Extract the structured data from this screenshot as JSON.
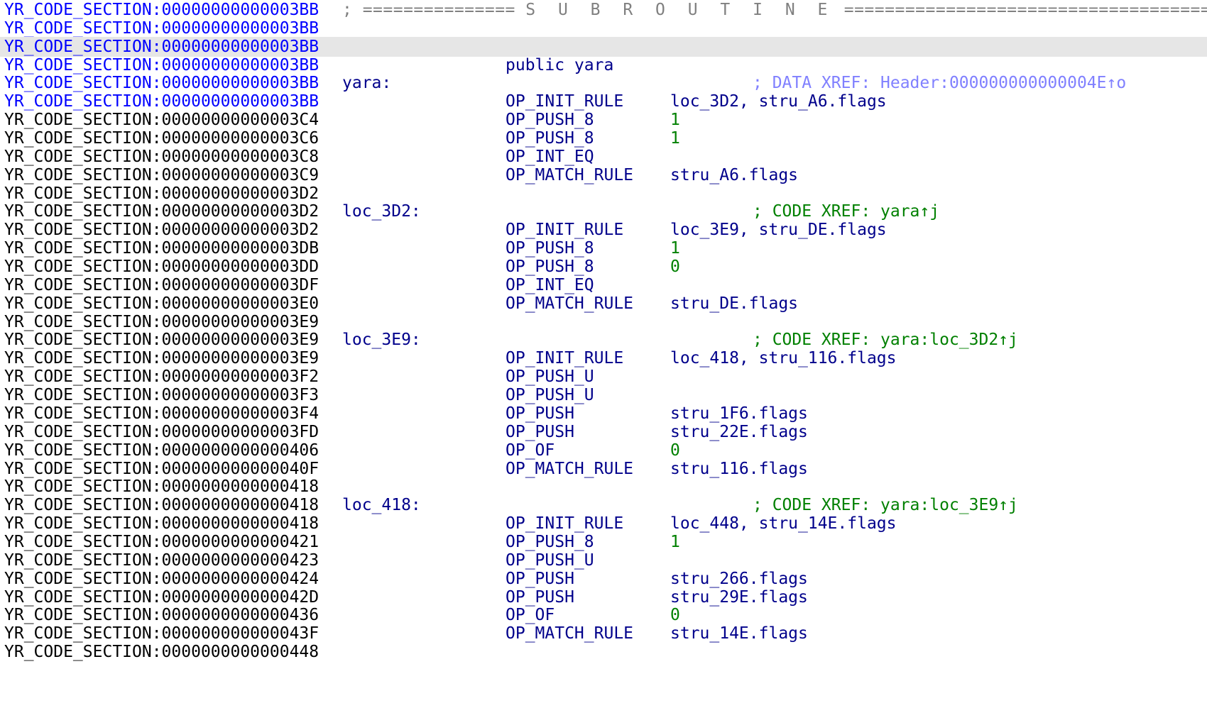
{
  "header": {
    "address": "YR_CODE_SECTION:00000000000003BB",
    "separator_left": "; ===============",
    "title": "S U B R O U T I N E",
    "separator_right": "========================================"
  },
  "rows": [
    {
      "addr": "YR_CODE_SECTION:00000000000003BB",
      "addr_color": "blue",
      "label": "",
      "mnemonic": "",
      "operand": "",
      "operand_kind": "",
      "xref": "",
      "xref_kind": ""
    },
    {
      "addr": "YR_CODE_SECTION:00000000000003BB",
      "addr_color": "blue",
      "label": "",
      "mnemonic": "",
      "operand": "",
      "operand_kind": "",
      "xref": "",
      "xref_kind": "",
      "highlight": true
    },
    {
      "addr": "YR_CODE_SECTION:00000000000003BB",
      "addr_color": "blue",
      "label": "",
      "mnemonic": "public yara",
      "operand": "",
      "operand_kind": "",
      "xref": "",
      "xref_kind": ""
    },
    {
      "addr": "YR_CODE_SECTION:00000000000003BB",
      "addr_color": "blue",
      "label": "yara:",
      "mnemonic": "",
      "operand": "",
      "operand_kind": "",
      "xref": "; DATA XREF: Header:000000000000004E↑o",
      "xref_kind": "data"
    },
    {
      "addr": "YR_CODE_SECTION:00000000000003BB",
      "addr_color": "blue",
      "label": "",
      "mnemonic": "OP_INIT_RULE",
      "operand": "loc_3D2, stru_A6.flags",
      "operand_kind": "name",
      "xref": "",
      "xref_kind": ""
    },
    {
      "addr": "YR_CODE_SECTION:00000000000003C4",
      "addr_color": "black",
      "label": "",
      "mnemonic": "OP_PUSH_8",
      "operand": "1",
      "operand_kind": "num",
      "xref": "",
      "xref_kind": ""
    },
    {
      "addr": "YR_CODE_SECTION:00000000000003C6",
      "addr_color": "black",
      "label": "",
      "mnemonic": "OP_PUSH_8",
      "operand": "1",
      "operand_kind": "num",
      "xref": "",
      "xref_kind": ""
    },
    {
      "addr": "YR_CODE_SECTION:00000000000003C8",
      "addr_color": "black",
      "label": "",
      "mnemonic": "OP_INT_EQ",
      "operand": "",
      "operand_kind": "",
      "xref": "",
      "xref_kind": ""
    },
    {
      "addr": "YR_CODE_SECTION:00000000000003C9",
      "addr_color": "black",
      "label": "",
      "mnemonic": "OP_MATCH_RULE",
      "operand": "stru_A6.flags",
      "operand_kind": "name",
      "xref": "",
      "xref_kind": ""
    },
    {
      "addr": "YR_CODE_SECTION:00000000000003D2",
      "addr_color": "black",
      "label": "",
      "mnemonic": "",
      "operand": "",
      "operand_kind": "",
      "xref": "",
      "xref_kind": ""
    },
    {
      "addr": "YR_CODE_SECTION:00000000000003D2",
      "addr_color": "black",
      "label": "loc_3D2:",
      "mnemonic": "",
      "operand": "",
      "operand_kind": "",
      "xref": "; CODE XREF: yara↑j",
      "xref_kind": "code"
    },
    {
      "addr": "YR_CODE_SECTION:00000000000003D2",
      "addr_color": "black",
      "label": "",
      "mnemonic": "OP_INIT_RULE",
      "operand": "loc_3E9, stru_DE.flags",
      "operand_kind": "name",
      "xref": "",
      "xref_kind": ""
    },
    {
      "addr": "YR_CODE_SECTION:00000000000003DB",
      "addr_color": "black",
      "label": "",
      "mnemonic": "OP_PUSH_8",
      "operand": "1",
      "operand_kind": "num",
      "xref": "",
      "xref_kind": ""
    },
    {
      "addr": "YR_CODE_SECTION:00000000000003DD",
      "addr_color": "black",
      "label": "",
      "mnemonic": "OP_PUSH_8",
      "operand": "0",
      "operand_kind": "num",
      "xref": "",
      "xref_kind": ""
    },
    {
      "addr": "YR_CODE_SECTION:00000000000003DF",
      "addr_color": "black",
      "label": "",
      "mnemonic": "OP_INT_EQ",
      "operand": "",
      "operand_kind": "",
      "xref": "",
      "xref_kind": ""
    },
    {
      "addr": "YR_CODE_SECTION:00000000000003E0",
      "addr_color": "black",
      "label": "",
      "mnemonic": "OP_MATCH_RULE",
      "operand": "stru_DE.flags",
      "operand_kind": "name",
      "xref": "",
      "xref_kind": ""
    },
    {
      "addr": "YR_CODE_SECTION:00000000000003E9",
      "addr_color": "black",
      "label": "",
      "mnemonic": "",
      "operand": "",
      "operand_kind": "",
      "xref": "",
      "xref_kind": ""
    },
    {
      "addr": "YR_CODE_SECTION:00000000000003E9",
      "addr_color": "black",
      "label": "loc_3E9:",
      "mnemonic": "",
      "operand": "",
      "operand_kind": "",
      "xref": "; CODE XREF: yara:loc_3D2↑j",
      "xref_kind": "code"
    },
    {
      "addr": "YR_CODE_SECTION:00000000000003E9",
      "addr_color": "black",
      "label": "",
      "mnemonic": "OP_INIT_RULE",
      "operand": "loc_418, stru_116.flags",
      "operand_kind": "name",
      "xref": "",
      "xref_kind": ""
    },
    {
      "addr": "YR_CODE_SECTION:00000000000003F2",
      "addr_color": "black",
      "label": "",
      "mnemonic": "OP_PUSH_U",
      "operand": "",
      "operand_kind": "",
      "xref": "",
      "xref_kind": ""
    },
    {
      "addr": "YR_CODE_SECTION:00000000000003F3",
      "addr_color": "black",
      "label": "",
      "mnemonic": "OP_PUSH_U",
      "operand": "",
      "operand_kind": "",
      "xref": "",
      "xref_kind": ""
    },
    {
      "addr": "YR_CODE_SECTION:00000000000003F4",
      "addr_color": "black",
      "label": "",
      "mnemonic": "OP_PUSH",
      "operand": "stru_1F6.flags",
      "operand_kind": "name",
      "xref": "",
      "xref_kind": ""
    },
    {
      "addr": "YR_CODE_SECTION:00000000000003FD",
      "addr_color": "black",
      "label": "",
      "mnemonic": "OP_PUSH",
      "operand": "stru_22E.flags",
      "operand_kind": "name",
      "xref": "",
      "xref_kind": ""
    },
    {
      "addr": "YR_CODE_SECTION:0000000000000406",
      "addr_color": "black",
      "label": "",
      "mnemonic": "OP_OF",
      "operand": "0",
      "operand_kind": "num",
      "xref": "",
      "xref_kind": ""
    },
    {
      "addr": "YR_CODE_SECTION:000000000000040F",
      "addr_color": "black",
      "label": "",
      "mnemonic": "OP_MATCH_RULE",
      "operand": "stru_116.flags",
      "operand_kind": "name",
      "xref": "",
      "xref_kind": ""
    },
    {
      "addr": "YR_CODE_SECTION:0000000000000418",
      "addr_color": "black",
      "label": "",
      "mnemonic": "",
      "operand": "",
      "operand_kind": "",
      "xref": "",
      "xref_kind": ""
    },
    {
      "addr": "YR_CODE_SECTION:0000000000000418",
      "addr_color": "black",
      "label": "loc_418:",
      "mnemonic": "",
      "operand": "",
      "operand_kind": "",
      "xref": "; CODE XREF: yara:loc_3E9↑j",
      "xref_kind": "code"
    },
    {
      "addr": "YR_CODE_SECTION:0000000000000418",
      "addr_color": "black",
      "label": "",
      "mnemonic": "OP_INIT_RULE",
      "operand": "loc_448, stru_14E.flags",
      "operand_kind": "name",
      "xref": "",
      "xref_kind": ""
    },
    {
      "addr": "YR_CODE_SECTION:0000000000000421",
      "addr_color": "black",
      "label": "",
      "mnemonic": "OP_PUSH_8",
      "operand": "1",
      "operand_kind": "num",
      "xref": "",
      "xref_kind": ""
    },
    {
      "addr": "YR_CODE_SECTION:0000000000000423",
      "addr_color": "black",
      "label": "",
      "mnemonic": "OP_PUSH_U",
      "operand": "",
      "operand_kind": "",
      "xref": "",
      "xref_kind": ""
    },
    {
      "addr": "YR_CODE_SECTION:0000000000000424",
      "addr_color": "black",
      "label": "",
      "mnemonic": "OP_PUSH",
      "operand": "stru_266.flags",
      "operand_kind": "name",
      "xref": "",
      "xref_kind": ""
    },
    {
      "addr": "YR_CODE_SECTION:000000000000042D",
      "addr_color": "black",
      "label": "",
      "mnemonic": "OP_PUSH",
      "operand": "stru_29E.flags",
      "operand_kind": "name",
      "xref": "",
      "xref_kind": ""
    },
    {
      "addr": "YR_CODE_SECTION:0000000000000436",
      "addr_color": "black",
      "label": "",
      "mnemonic": "OP_OF",
      "operand": "0",
      "operand_kind": "num",
      "xref": "",
      "xref_kind": ""
    },
    {
      "addr": "YR_CODE_SECTION:000000000000043F",
      "addr_color": "black",
      "label": "",
      "mnemonic": "OP_MATCH_RULE",
      "operand": "stru_14E.flags",
      "operand_kind": "name",
      "xref": "",
      "xref_kind": ""
    },
    {
      "addr": "YR_CODE_SECTION:0000000000000448",
      "addr_color": "black",
      "label": "",
      "mnemonic": "",
      "operand": "",
      "operand_kind": "",
      "xref": "",
      "xref_kind": ""
    }
  ],
  "colors": {
    "address_blue": "#0000ff",
    "address_black": "#000000",
    "code_dark_blue": "#00008b",
    "number_green": "#008000",
    "code_xref_green": "#008000",
    "data_xref_lavender": "#8080ff",
    "separator_gray": "#808080",
    "highlight_row": "#e6e6e6",
    "background": "#ffffff"
  }
}
